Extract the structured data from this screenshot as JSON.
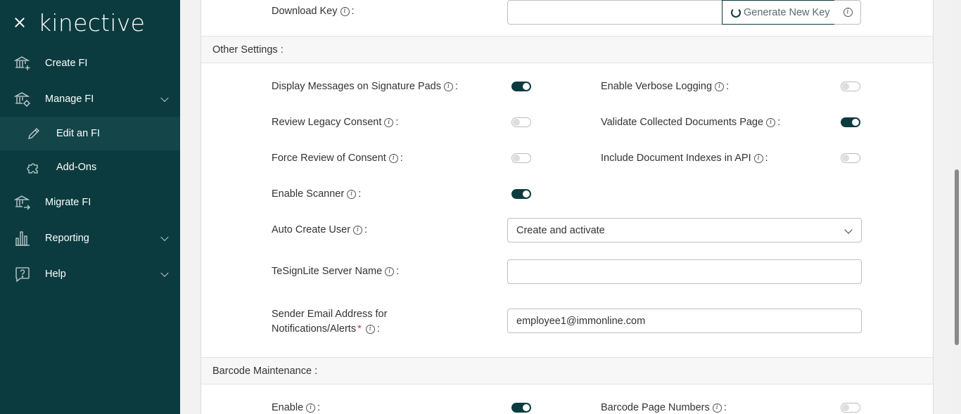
{
  "sidebar": {
    "logo": "kinective",
    "items": [
      {
        "label": "Create FI",
        "icon": "bank-add-icon"
      },
      {
        "label": "Manage FI",
        "icon": "bank-gear-icon"
      },
      {
        "label": "Edit an FI",
        "icon": "pencil-icon"
      },
      {
        "label": "Add-Ons",
        "icon": "puzzle-icon"
      },
      {
        "label": "Migrate FI",
        "icon": "bank-arrow-icon"
      },
      {
        "label": "Reporting",
        "icon": "bar-chart-icon"
      },
      {
        "label": "Help",
        "icon": "help-bubble-icon"
      }
    ]
  },
  "download_key": {
    "label": "Download Key",
    "value": "",
    "generate_label": "Generate New Key"
  },
  "other_settings": {
    "title": "Other Settings :",
    "display_messages": {
      "label": "Display Messages on Signature Pads",
      "on": true
    },
    "verbose_logging": {
      "label": "Enable Verbose Logging",
      "on": false
    },
    "review_legacy": {
      "label": "Review Legacy Consent",
      "on": false
    },
    "validate_docs": {
      "label": "Validate Collected Documents Page",
      "on": true
    },
    "force_review": {
      "label": "Force Review of Consent",
      "on": false
    },
    "doc_indexes": {
      "label": "Include Document Indexes in API",
      "on": false
    },
    "enable_scanner": {
      "label": "Enable Scanner",
      "on": true
    },
    "auto_create_user": {
      "label": "Auto Create User",
      "value": "Create and activate"
    },
    "tesignlite": {
      "label": "TeSignLite Server Name",
      "value": ""
    },
    "sender_email": {
      "label_line1": "Sender Email Address for",
      "label_line2": "Notifications/Alerts",
      "required": "*",
      "value": "employee1@immonline.com"
    }
  },
  "barcode": {
    "title": "Barcode Maintenance :",
    "enable": {
      "label": "Enable",
      "on": true
    },
    "page_numbers": {
      "label": "Barcode Page Numbers",
      "on": false
    }
  },
  "colon": ":",
  "info_glyph": "i"
}
